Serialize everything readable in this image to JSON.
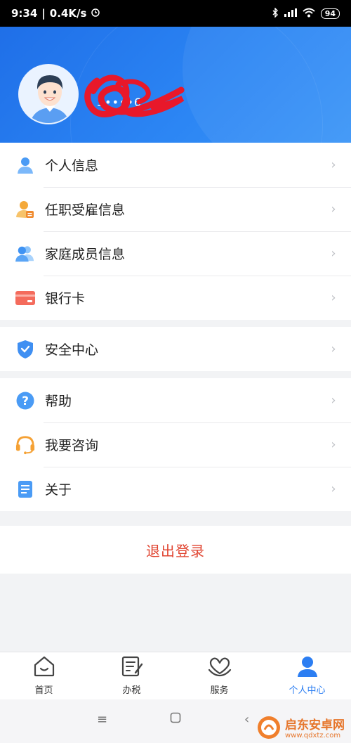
{
  "status_bar": {
    "time": "9:34",
    "speed": "0.4K/s",
    "battery": "94"
  },
  "profile": {
    "name": "",
    "id": "3••••6"
  },
  "menu_groups": [
    {
      "items": [
        {
          "label": "个人信息",
          "icon": "person-icon"
        },
        {
          "label": "任职受雇信息",
          "icon": "employment-icon"
        },
        {
          "label": "家庭成员信息",
          "icon": "family-icon"
        },
        {
          "label": "银行卡",
          "icon": "bank-card-icon"
        }
      ]
    },
    {
      "items": [
        {
          "label": "安全中心",
          "icon": "shield-icon"
        }
      ]
    },
    {
      "items": [
        {
          "label": "帮助",
          "icon": "help-icon"
        },
        {
          "label": "我要咨询",
          "icon": "headset-icon"
        },
        {
          "label": "关于",
          "icon": "document-icon"
        }
      ]
    }
  ],
  "logout_label": "退出登录",
  "tabs": [
    {
      "label": "首页",
      "icon": "home-icon",
      "active": false
    },
    {
      "label": "办税",
      "icon": "tax-icon",
      "active": false
    },
    {
      "label": "服务",
      "icon": "service-icon",
      "active": false
    },
    {
      "label": "个人中心",
      "icon": "user-center-icon",
      "active": true
    }
  ],
  "watermark": {
    "title": "启东安卓网",
    "url": "www.qdxtz.com"
  },
  "colors": {
    "accent": "#2c7ef2",
    "logout": "#e0432f",
    "header": "#1f6fe8"
  }
}
